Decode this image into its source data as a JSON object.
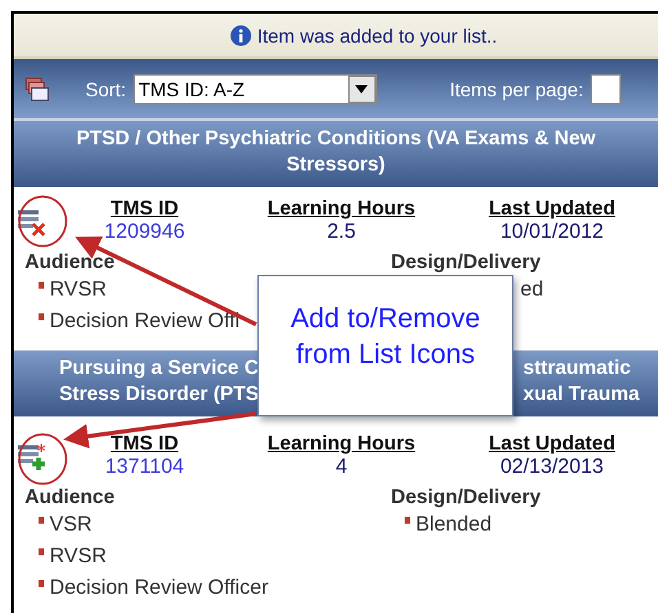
{
  "message": {
    "text": "Item was added to your list.."
  },
  "toolbar": {
    "sort_label": "Sort:",
    "sort_value": "TMS ID: A-Z",
    "items_per_page_label": "Items per page:"
  },
  "courses": [
    {
      "title_lines": [
        {
          "left": "PTSD / Other Psychiatric Conditions (VA Exams & New"
        },
        {
          "left": "Stressors)"
        }
      ],
      "in_list": true,
      "fields": [
        {
          "label": "TMS ID",
          "value": "1209946",
          "link": true
        },
        {
          "label": "Learning Hours",
          "value": "2.5",
          "link": false
        },
        {
          "label": "Last Updated",
          "value": "10/01/2012",
          "link": false
        }
      ],
      "sections": [
        {
          "heading": "Audience",
          "items": [
            {
              "text": "RVSR",
              "bullet": true
            },
            {
              "text": "Decision Review Offi",
              "bullet": true
            }
          ]
        },
        {
          "heading": "Design/Delivery",
          "items": [
            {
              "text": "ed",
              "bullet": false
            }
          ]
        }
      ]
    },
    {
      "title_lines": [
        {
          "left": "Pursuing a Service C",
          "right": "sttraumatic"
        },
        {
          "left": "Stress Disorder (PTS",
          "right": "xual Trauma"
        }
      ],
      "in_list": false,
      "fields": [
        {
          "label": "TMS ID",
          "value": "1371104",
          "link": true
        },
        {
          "label": "Learning Hours",
          "value": "4",
          "link": false
        },
        {
          "label": "Last Updated",
          "value": "02/13/2013",
          "link": false
        }
      ],
      "sections": [
        {
          "heading": "Audience",
          "items": [
            {
              "text": "VSR",
              "bullet": true
            },
            {
              "text": "RVSR",
              "bullet": true
            },
            {
              "text": "Decision Review Officer",
              "bullet": true
            }
          ]
        },
        {
          "heading": "Design/Delivery",
          "items": [
            {
              "text": "Blended",
              "bullet": true
            }
          ]
        }
      ]
    }
  ],
  "callout": {
    "text": "Add to/Remove from List Icons"
  }
}
